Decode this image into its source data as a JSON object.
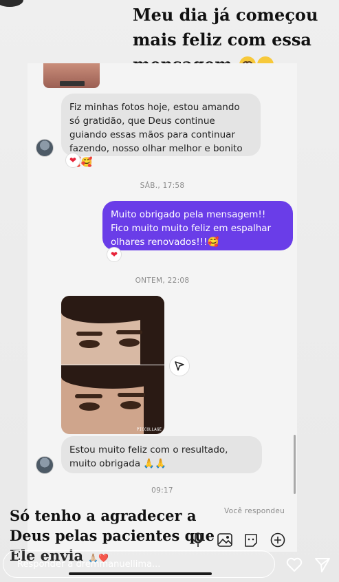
{
  "headline": {
    "text": "Meu dia já começou mais feliz com essa mensagem",
    "emoji_1": "pleading-face-emoji",
    "emoji_2": "heart-eyes-emoji"
  },
  "chat": {
    "messages": [
      {
        "from": "them",
        "text": "Fiz minhas fotos hoje, estou amando só gratidão, que Deus continue guiando essas mãos para continuar fazendo, nosso olhar melhor e bonito 🥰🥰",
        "reaction": "❤"
      },
      {
        "timestamp": "SÁB., 17:58"
      },
      {
        "from": "me",
        "text": "Muito obrigado pela mensagem!! Fico muito muito feliz em espalhar olhares renovados!!!🥰",
        "reaction": "❤"
      },
      {
        "timestamp": "ONTEM, 22:08"
      },
      {
        "from": "them",
        "photo_watermark": "PICCOLLAGE"
      },
      {
        "from": "them",
        "text": "Estou muito feliz com o resultado, muito obrigada 🙏🙏"
      },
      {
        "timestamp": "09:17"
      },
      {
        "status": "Você respondeu"
      }
    ]
  },
  "caption": {
    "text": "Só tenho a agradecer a Deus pelas pacientes que Ele envia",
    "trailing_emoji": "🙏🏼❤️"
  },
  "composer": {
    "icons": [
      "microphone-icon",
      "gallery-icon",
      "sticker-icon",
      "plus-icon"
    ]
  },
  "reply": {
    "placeholder": "Responder a dremmanuellima..."
  },
  "actions": [
    "heart-icon",
    "send-icon"
  ],
  "colors": {
    "outgoing_bubble": "#6a3de8",
    "incoming_bubble": "#e4e4e4",
    "reaction_heart": "#e8243a"
  }
}
